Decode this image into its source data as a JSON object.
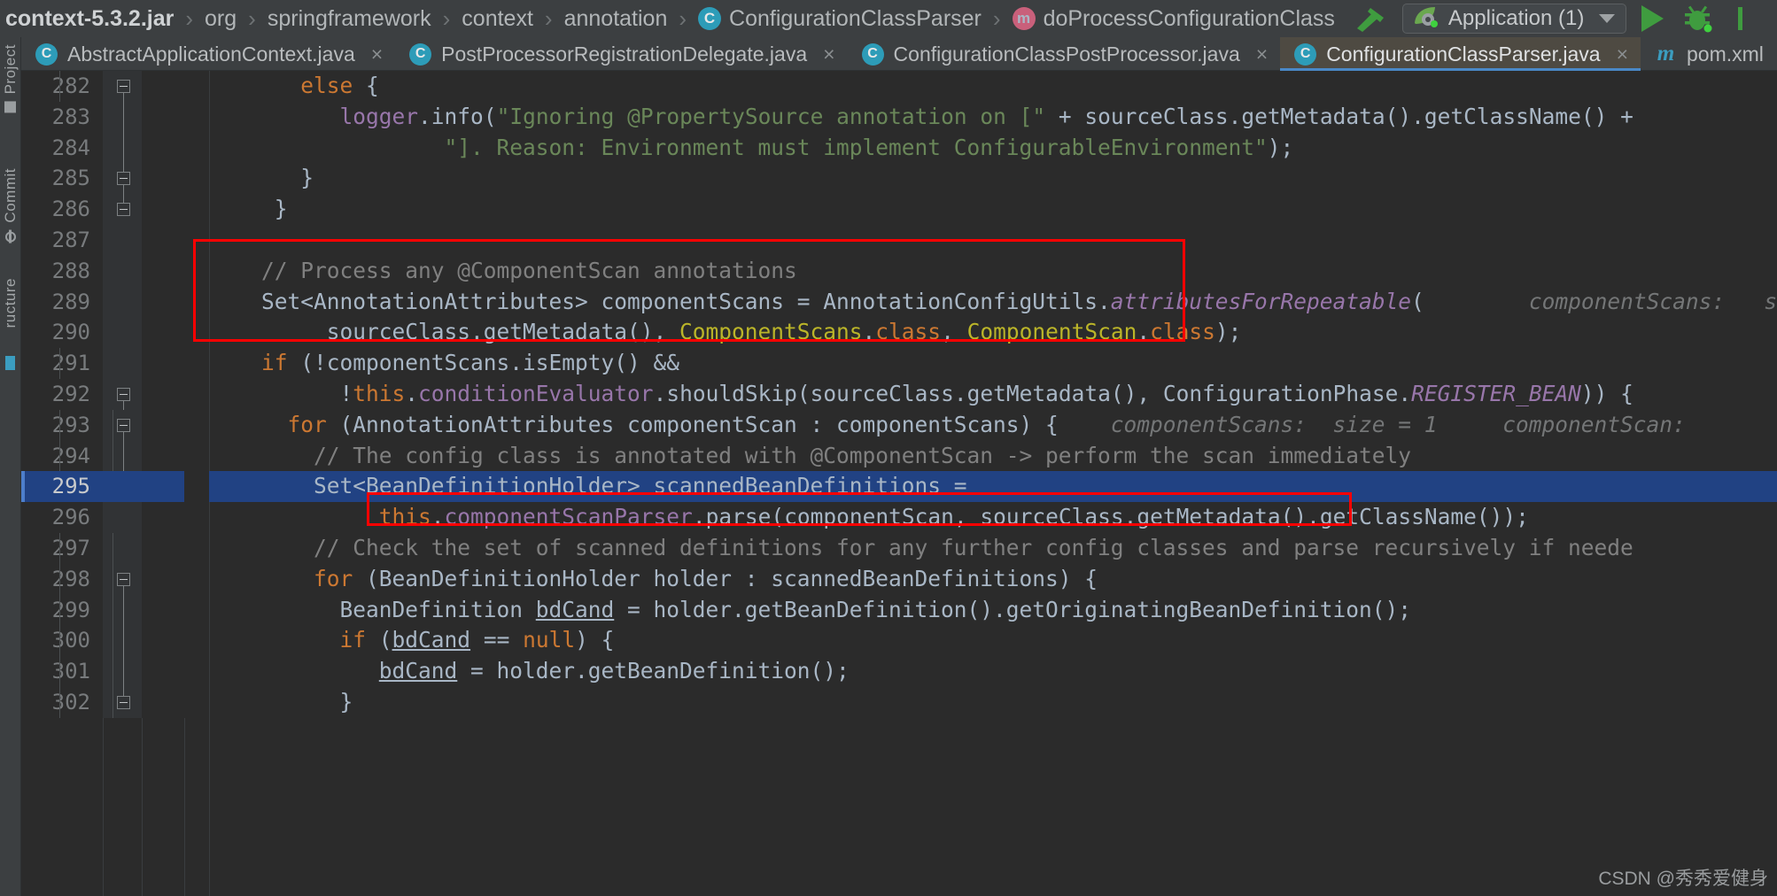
{
  "breadcrumb": {
    "items": [
      {
        "label": "context-5.3.2.jar",
        "icon": null
      },
      {
        "label": "org",
        "icon": null
      },
      {
        "label": "springframework",
        "icon": null
      },
      {
        "label": "context",
        "icon": null
      },
      {
        "label": "annotation",
        "icon": null
      },
      {
        "label": "ConfigurationClassParser",
        "icon": "class-icon",
        "badge": "C"
      },
      {
        "label": "doProcessConfigurationClass",
        "icon": "method-icon",
        "badge": "m"
      }
    ],
    "separator": "›"
  },
  "toolbar": {
    "build_icon": "hammer-icon",
    "run_config": "Application (1)",
    "run_icon": "run-icon",
    "debug_icon": "debug-icon",
    "dropdown_icon": "chevron-down-icon",
    "accent_green": "#3f9c3f"
  },
  "sidebar": {
    "items": [
      {
        "label": "Project",
        "icon": "project-icon"
      },
      {
        "label": "Commit",
        "icon": "commit-icon"
      },
      {
        "label": "ructure",
        "icon": "structure-icon"
      }
    ]
  },
  "tabs": {
    "items": [
      {
        "label": "AbstractApplicationContext.java",
        "badge": "C",
        "type": "class",
        "active": false,
        "close": "×"
      },
      {
        "label": "PostProcessorRegistrationDelegate.java",
        "badge": "C",
        "type": "class",
        "active": false,
        "close": "×"
      },
      {
        "label": "ConfigurationClassPostProcessor.java",
        "badge": "C",
        "type": "class",
        "active": false,
        "close": "×"
      },
      {
        "label": "ConfigurationClassParser.java",
        "badge": "C",
        "type": "class",
        "active": true,
        "close": "×"
      },
      {
        "label": "pom.xml",
        "badge": "m",
        "type": "xml",
        "active": false,
        "close": ""
      }
    ]
  },
  "editor": {
    "selected_line": 295,
    "first_line": 282,
    "lines": [
      {
        "n": "282",
        "fold": "open"
      },
      {
        "n": "283"
      },
      {
        "n": "284"
      },
      {
        "n": "285",
        "fold": "close"
      },
      {
        "n": "286",
        "fold": "close"
      },
      {
        "n": "287"
      },
      {
        "n": "288"
      },
      {
        "n": "289"
      },
      {
        "n": "290"
      },
      {
        "n": "291"
      },
      {
        "n": "292",
        "fold": "open"
      },
      {
        "n": "293",
        "fold": "open"
      },
      {
        "n": "294"
      },
      {
        "n": "295"
      },
      {
        "n": "296"
      },
      {
        "n": "297"
      },
      {
        "n": "298",
        "fold": "open"
      },
      {
        "n": "299"
      },
      {
        "n": "300"
      },
      {
        "n": "301"
      },
      {
        "n": "302",
        "fold": "close"
      }
    ],
    "inlay_hints": [
      "componentScans:",
      "componentScans:  size = 1",
      "componentScan:"
    ]
  },
  "watermark": "CSDN @秀秀爱健身",
  "annotations": {
    "box1_label": "red-highlight-box-componentscan-parse",
    "box2_label": "red-highlight-box-scanparser-call",
    "color": "#fe0000"
  }
}
